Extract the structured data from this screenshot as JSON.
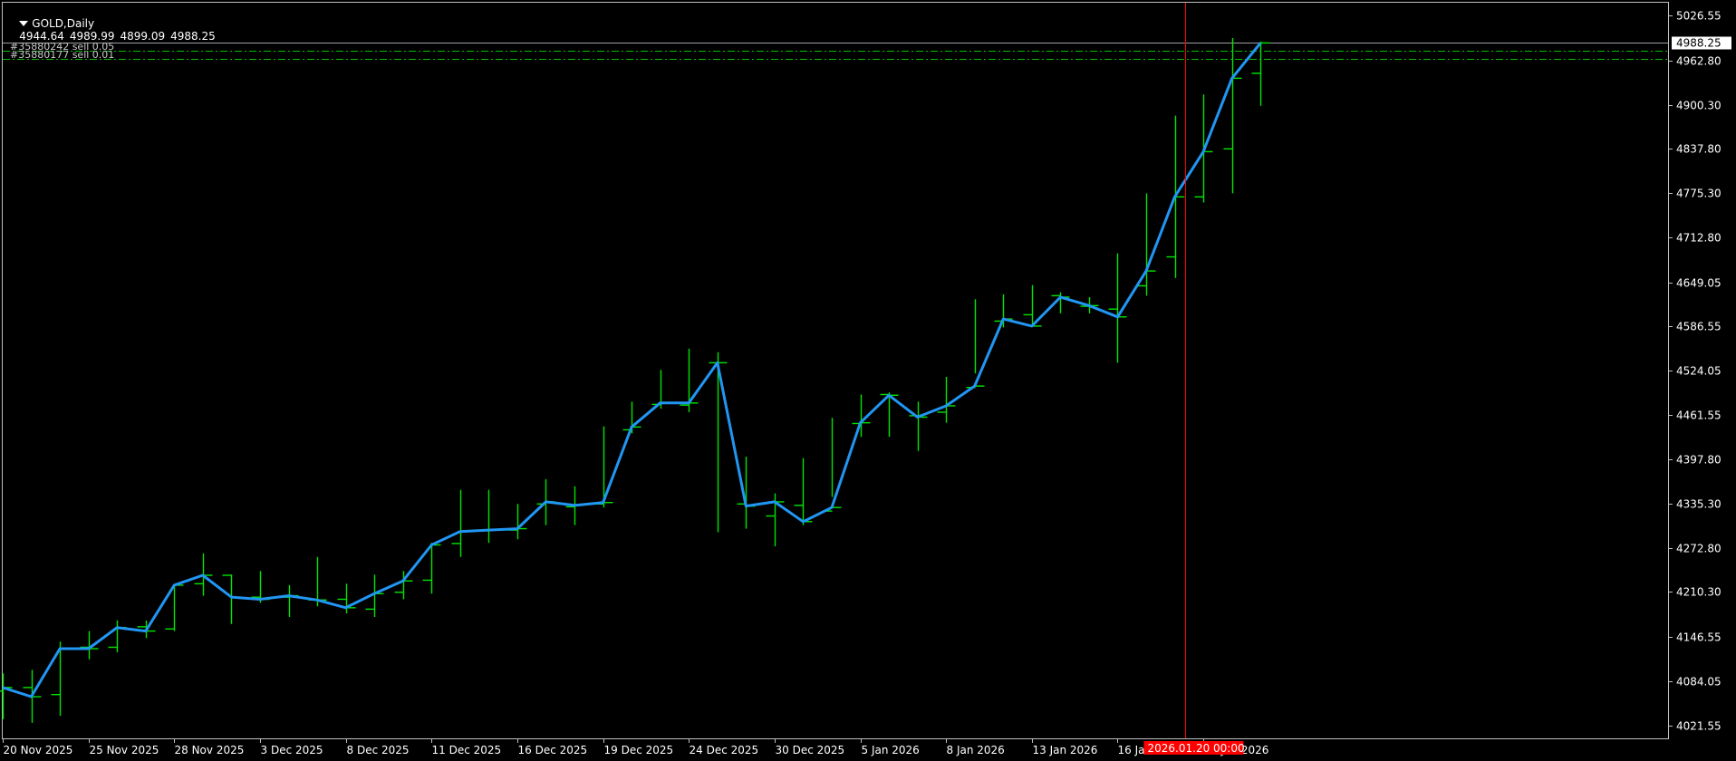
{
  "header": {
    "symbol": "GOLD,Daily",
    "open": "4944.64",
    "high": "4989.99",
    "low": "4899.09",
    "close": "4988.25"
  },
  "orders": [
    {
      "label": "#35880242 sell 0.05",
      "price": 4977.5
    },
    {
      "label": "#35880177 sell 0.01",
      "price": 4966.0
    }
  ],
  "current_price": {
    "label": "4988.25",
    "value": 4988.25
  },
  "crosshair": {
    "label": "2026.01.20 00:00"
  },
  "colors": {
    "background": "#000000",
    "bars": "#00e600",
    "line": "#2196f3",
    "order_line": "#00c000",
    "crosshair": "#ff0000",
    "price_line": "#9aa0a6"
  },
  "chart_data": {
    "type": "line",
    "title": "",
    "xlabel": "",
    "ylabel": "",
    "ylim": [
      4003.0,
      5045.0
    ],
    "y_ticks": [
      "5026.55",
      "4962.80",
      "4900.30",
      "4837.80",
      "4775.30",
      "4712.80",
      "4649.05",
      "4586.55",
      "4524.05",
      "4461.55",
      "4397.80",
      "4335.30",
      "4272.80",
      "4210.30",
      "4146.55",
      "4084.05",
      "4021.55"
    ],
    "x_tick_labels": [
      {
        "label": "20 Nov 2025",
        "index": 0
      },
      {
        "label": "25 Nov 2025",
        "index": 3
      },
      {
        "label": "28 Nov 2025",
        "index": 6
      },
      {
        "label": "3 Dec 2025",
        "index": 9
      },
      {
        "label": "8 Dec 2025",
        "index": 12
      },
      {
        "label": "11 Dec 2025",
        "index": 15
      },
      {
        "label": "16 Dec 2025",
        "index": 18
      },
      {
        "label": "19 Dec 2025",
        "index": 21
      },
      {
        "label": "24 Dec 2025",
        "index": 24
      },
      {
        "label": "30 Dec 2025",
        "index": 27
      },
      {
        "label": "5 Jan 2026",
        "index": 30
      },
      {
        "label": "8 Jan 2026",
        "index": 33
      },
      {
        "label": "13 Jan 2026",
        "index": 36
      },
      {
        "label": "16 Jan 2026",
        "index": 39
      },
      {
        "label": "21 Jan 2026",
        "index": 42
      }
    ],
    "crosshair_index": 41,
    "series": [
      {
        "type": "ohlc",
        "open": [
          4070,
          4075,
          4065,
          4132,
          4132,
          4161,
          4158,
          4222,
          4234,
          4203,
          4203,
          4199,
          4200,
          4186,
          4210,
          4227,
          4279,
          4297,
          4298,
          4335,
          4331,
          4335,
          4440,
          4476,
          4475,
          4535,
          4335,
          4318,
          4333,
          4325,
          4449,
          4490,
          4460,
          4465,
          4500,
          4594,
          4603,
          4630,
          4615,
          4611,
          4644,
          4685,
          4770,
          4838,
          4945
        ],
        "high": [
          4095,
          4100,
          4140,
          4155,
          4170,
          4170,
          4220,
          4265,
          4235,
          4240,
          4220,
          4260,
          4222,
          4235,
          4240,
          4280,
          4355,
          4355,
          4335,
          4370,
          4360,
          4445,
          4480,
          4525,
          4555,
          4550,
          4402,
          4350,
          4400,
          4457,
          4490,
          4493,
          4480,
          4515,
          4625,
          4632,
          4645,
          4635,
          4628,
          4690,
          4775,
          4885,
          4915,
          4995,
          4990
        ],
        "low": [
          4030,
          4025,
          4035,
          4115,
          4125,
          4145,
          4155,
          4205,
          4165,
          4195,
          4175,
          4190,
          4180,
          4175,
          4200,
          4208,
          4260,
          4280,
          4285,
          4305,
          4305,
          4330,
          4435,
          4470,
          4465,
          4295,
          4300,
          4275,
          4305,
          4345,
          4430,
          4430,
          4410,
          4450,
          4520,
          4585,
          4590,
          4605,
          4605,
          4535,
          4630,
          4655,
          4762,
          4775,
          4899
        ],
        "close": [
          4075,
          4062,
          4130,
          4130,
          4160,
          4155,
          4220,
          4234,
          4203,
          4200,
          4205,
          4199,
          4188,
          4208,
          4226,
          4277,
          4296,
          4298,
          4300,
          4338,
          4333,
          4337,
          4444,
          4478,
          4478,
          4535,
          4332,
          4338,
          4310,
          4330,
          4450,
          4489,
          4458,
          4474,
          4502,
          4597,
          4587,
          4628,
          4616,
          4600,
          4665,
          4770,
          4834,
          4938,
          4988
        ]
      },
      {
        "type": "line",
        "values": [
          4075,
          4062,
          4130,
          4130,
          4160,
          4155,
          4220,
          4234,
          4203,
          4200,
          4205,
          4199,
          4188,
          4208,
          4226,
          4277,
          4296,
          4298,
          4300,
          4338,
          4333,
          4337,
          4444,
          4478,
          4478,
          4535,
          4332,
          4338,
          4310,
          4330,
          4450,
          4489,
          4458,
          4474,
          4502,
          4597,
          4587,
          4628,
          4616,
          4600,
          4665,
          4770,
          4834,
          4938,
          4988
        ]
      }
    ]
  }
}
